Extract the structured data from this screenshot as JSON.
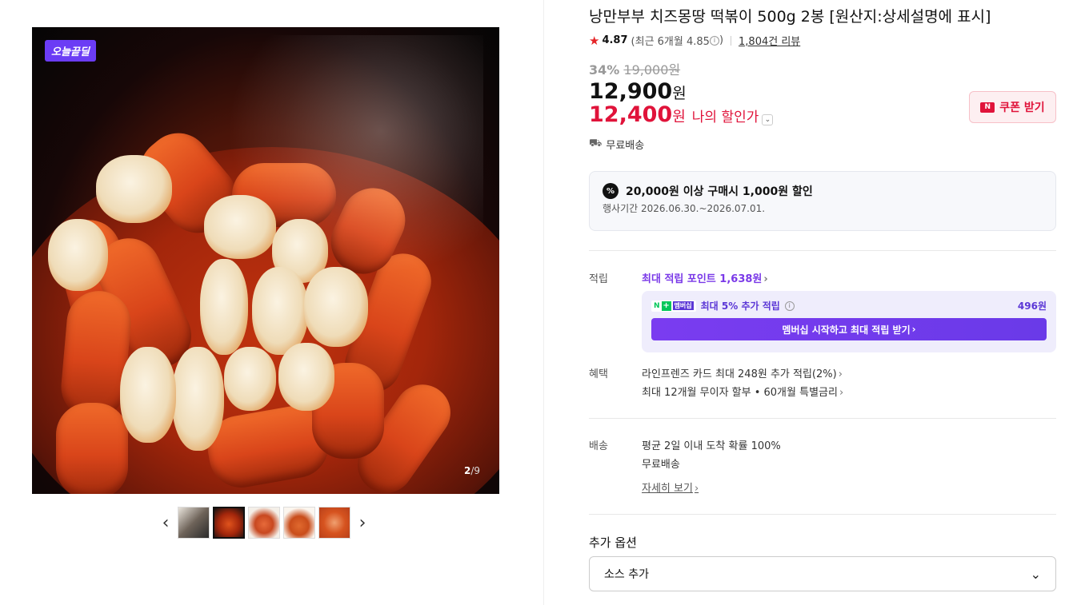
{
  "gallery": {
    "badge": "오늘끝딜",
    "counter_current": "2",
    "counter_total": "/9",
    "prev_icon": "chevron-left-icon",
    "next_icon": "chevron-right-icon",
    "thumbnail_count": 5,
    "active_thumbnail": 2
  },
  "product": {
    "title": "낭만부부 치즈몽땅 떡볶이 500g 2봉 [원산지:상세설명에 표시]",
    "rating": "4.87",
    "rating_sub": "(최근 6개월 4.85",
    "rating_sub_close": ")",
    "reviews": "1,804건 리뷰",
    "discount_pct": "34%",
    "original_price": "19,000원",
    "price": "12,900",
    "price_unit": "원",
    "my_price": "12,400",
    "my_price_unit": "원",
    "my_price_label": "나의 할인가",
    "coupon_button": "쿠폰 받기",
    "shipping": "무료배송"
  },
  "promo": {
    "headline": "20,000원 이상 구매시 1,000원 할인",
    "period": "행사기간 2026.06.30.~2026.07.01."
  },
  "points": {
    "label": "적립",
    "link": "최대 적립 포인트 1,638원",
    "membership_n": "N",
    "membership_plus": "+",
    "membership_tag": "멤버십",
    "membership_text": "최대 5% 추가 적립",
    "membership_amount": "496원",
    "membership_button": "멤버십 시작하고 최대 적립 받기"
  },
  "benefits": {
    "label": "혜택",
    "items": [
      "라인프렌즈 카드 최대 248원 추가 적립(2%)",
      "최대 12개월 무이자 할부 • 60개월 특별금리"
    ]
  },
  "delivery": {
    "label": "배송",
    "line1": "평균 2일 이내 도착 확률 100%",
    "line2": "무료배송",
    "detail_link": "자세히 보기"
  },
  "options": {
    "title": "추가 옵션",
    "selected": "소스 추가"
  },
  "colors": {
    "accent_red": "#e0133a",
    "accent_purple": "#7a39e8",
    "deal_badge": "#6b3cf5"
  }
}
